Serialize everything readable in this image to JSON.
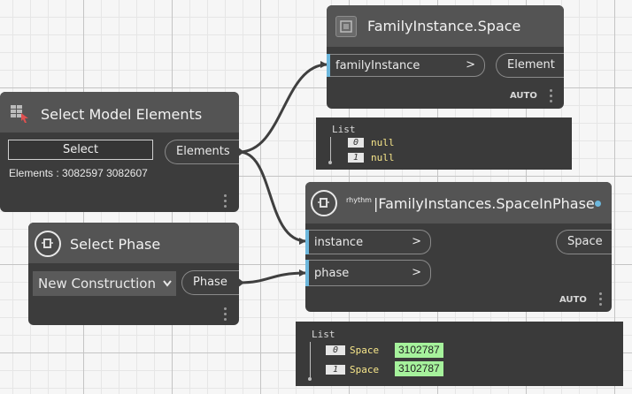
{
  "node_family_space": {
    "title": "FamilyInstance.Space",
    "input_label": "familyInstance",
    "output_label": "Element",
    "auto_label": "AUTO",
    "preview": {
      "header": "List",
      "items": [
        {
          "index": "0",
          "value": "null"
        },
        {
          "index": "1",
          "value": "null"
        }
      ]
    }
  },
  "node_select_elements": {
    "title": "Select Model Elements",
    "select_button": "Select",
    "output_label": "Elements",
    "elements_text": "Elements : 3082597 3082607"
  },
  "node_space_in_phase": {
    "title_prefix": "rhythm",
    "title": "|FamilyInstances.SpaceInPhase",
    "input_1": "instance",
    "input_2": "phase",
    "output_label": "Space",
    "auto_label": "AUTO",
    "preview": {
      "header": "List",
      "items": [
        {
          "index": "0",
          "type": "Space",
          "value": "3102787"
        },
        {
          "index": "1",
          "type": "Space",
          "value": "3102787"
        }
      ]
    }
  },
  "node_select_phase": {
    "title": "Select Phase",
    "dropdown_value": "New Construction",
    "output_label": "Phase"
  },
  "chevron": ">",
  "colors": {
    "accent_port": "#6db7dc",
    "wire": "#3f3f3f",
    "value_highlight": "#a6f29c",
    "null_text": "#f7e68a"
  }
}
